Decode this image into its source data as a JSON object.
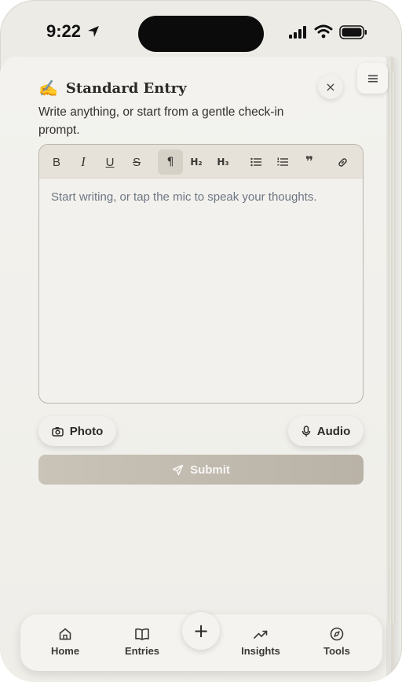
{
  "status": {
    "time": "9:22"
  },
  "entry": {
    "emoji": "✍️",
    "title": "Standard Entry",
    "subtitle": "Write anything, or start from a gentle check-in prompt.",
    "close_glyph": "×"
  },
  "toolbar": {
    "bold": "B",
    "italic": "I",
    "underline": "U",
    "strike": "S",
    "paragraph": "¶",
    "h2": "H₂",
    "h3": "H₃",
    "quote": "❞"
  },
  "editor": {
    "placeholder": "Start writing, or tap the mic to speak your thoughts."
  },
  "attachments": {
    "photo_label": "Photo",
    "audio_label": "Audio"
  },
  "submit_label": "Submit",
  "tabs": [
    {
      "label": "Home"
    },
    {
      "label": "Entries"
    },
    {
      "label": "Insights"
    },
    {
      "label": "Tools"
    }
  ],
  "fab_glyph": "+"
}
